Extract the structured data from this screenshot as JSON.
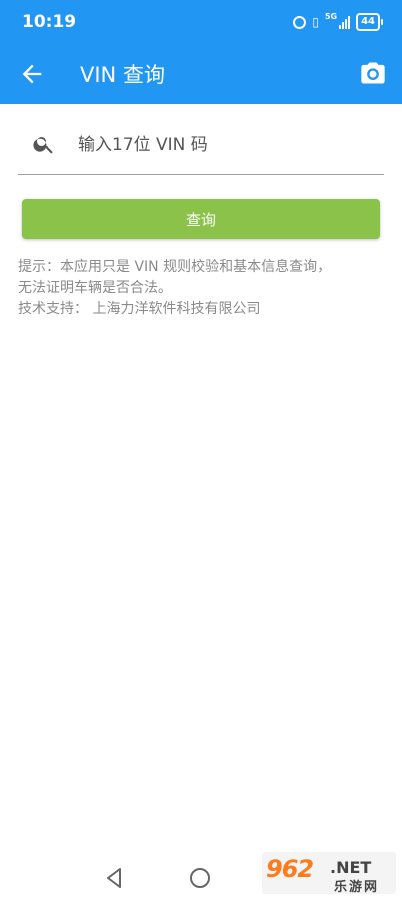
{
  "status_bar": {
    "time": "10:19",
    "network": "5G",
    "battery": "44"
  },
  "app_bar": {
    "title": "VIN 查询",
    "back_icon": "arrow-back-icon",
    "camera_icon": "camera-icon"
  },
  "search": {
    "placeholder": "输入17位 VIN 码",
    "value": "",
    "icon": "search-icon"
  },
  "query_button": {
    "label": "查询"
  },
  "hint": {
    "line1": "提示：本应用只是 VIN 规则校验和基本信息查询，",
    "line2": "无法证明车辆是否合法。",
    "line3": "技术支持： 上海力洋软件科技有限公司"
  },
  "watermark": {
    "logo": "962",
    "domain": ".NET",
    "name": "乐游网"
  },
  "colors": {
    "primary": "#2196f3",
    "button": "#8bc34a",
    "hint_text": "#8a8a8a"
  }
}
